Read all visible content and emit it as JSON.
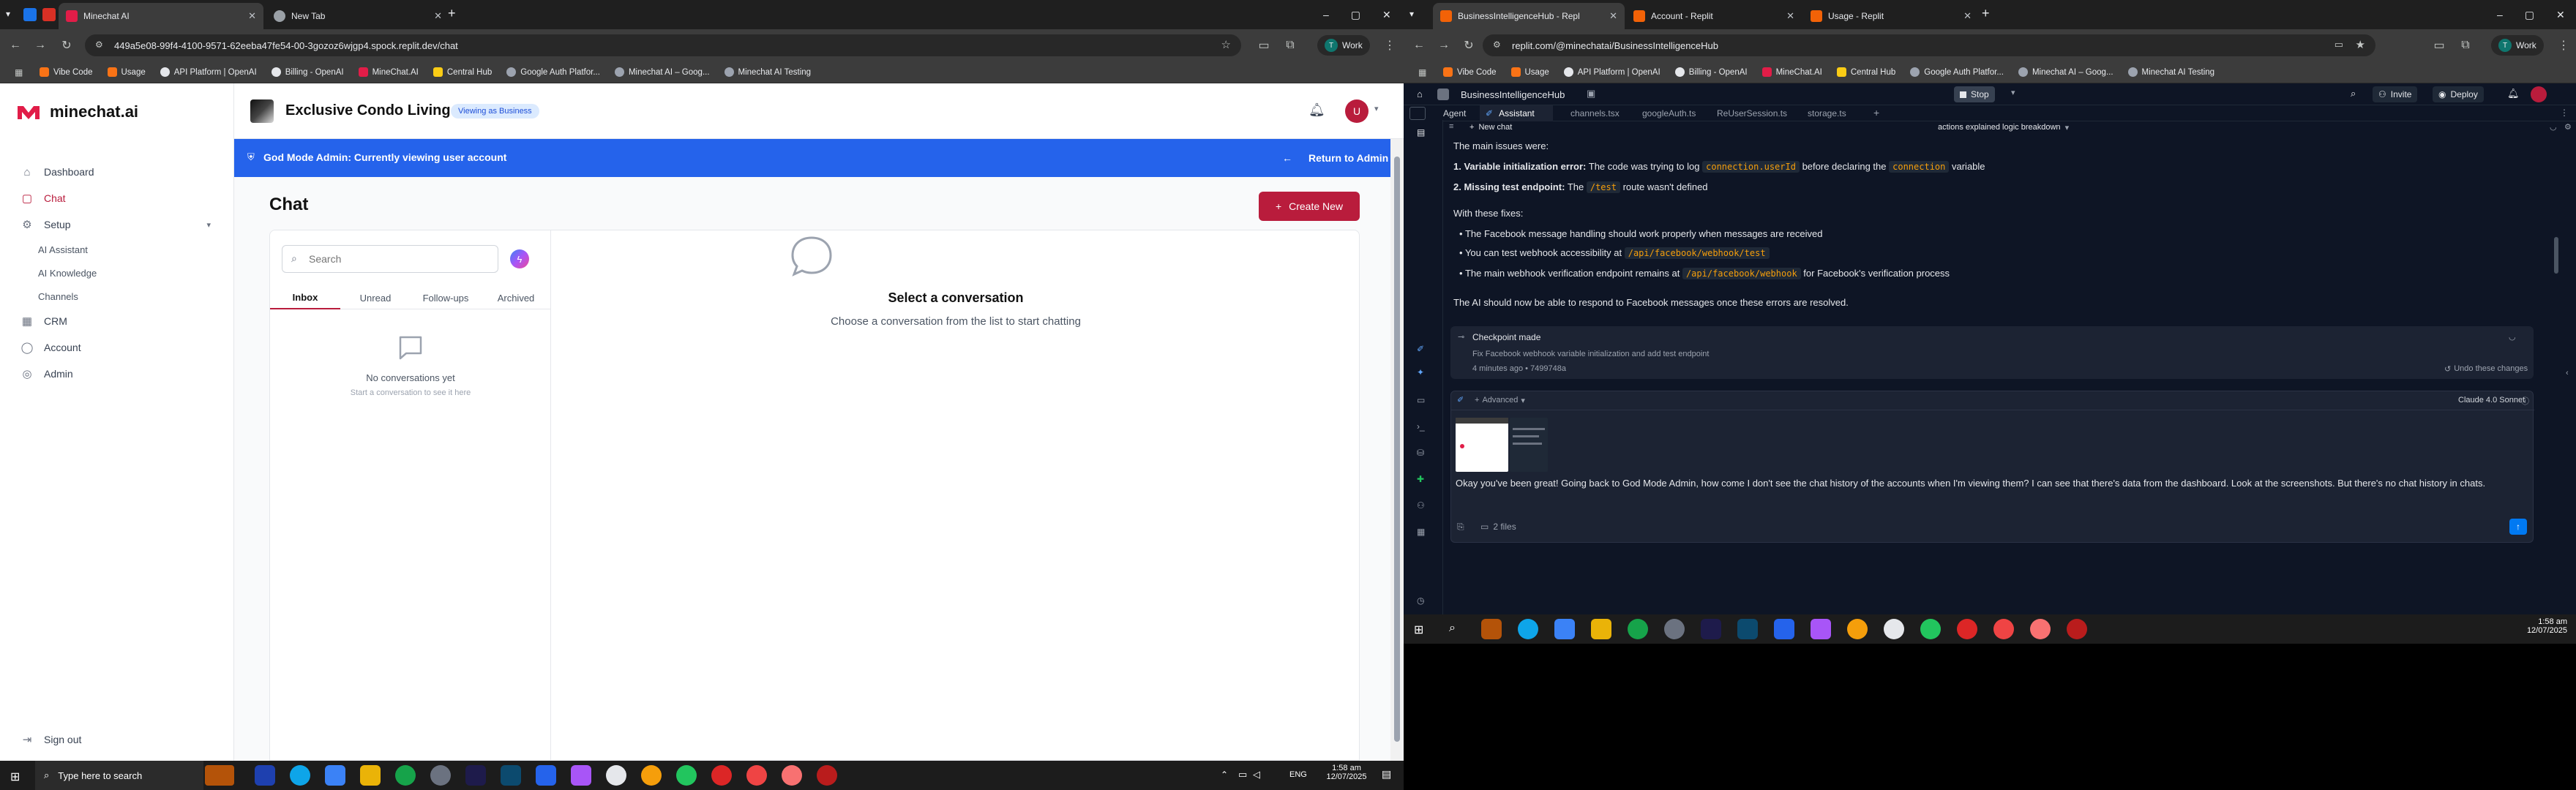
{
  "left_browser": {
    "tabs": [
      {
        "title": "Minechat AI",
        "active": true
      },
      {
        "title": "New Tab",
        "active": false
      }
    ],
    "url": "449a5e08-99f4-4100-9571-62eeba47fe54-00-3gozoz6wjgp4.spock.replit.dev/chat",
    "profile_label": "Work",
    "bookmarks": [
      "Vibe Code",
      "Usage",
      "API Platform | OpenAI",
      "Billing - OpenAI",
      "MineChat.AI",
      "Central Hub",
      "Google Auth Platfor...",
      "Minechat AI – Goog...",
      "Minechat AI Testing"
    ]
  },
  "app": {
    "brand": "minechat.ai",
    "business_name": "Exclusive Condo Living",
    "viewing_badge": "Viewing as Business",
    "avatar_letter": "U",
    "banner_text": "God Mode Admin: Currently viewing user account",
    "return_label": "Return to Admin",
    "sidebar": {
      "items": [
        {
          "label": "Dashboard"
        },
        {
          "label": "Chat"
        },
        {
          "label": "Setup"
        },
        {
          "label": "CRM"
        },
        {
          "label": "Account"
        },
        {
          "label": "Admin"
        }
      ],
      "setup_sub": [
        "AI Assistant",
        "AI Knowledge",
        "Channels"
      ],
      "signout": "Sign out"
    },
    "chat": {
      "title": "Chat",
      "create_label": "Create New",
      "search_placeholder": "Search",
      "tabs": [
        "Inbox",
        "Unread",
        "Follow-ups",
        "Archived"
      ],
      "empty_title": "No conversations yet",
      "empty_sub": "Start a conversation to see it here",
      "select_title": "Select a conversation",
      "select_sub": "Choose a conversation from the list to start chatting"
    }
  },
  "right_browser": {
    "tabs": [
      {
        "title": "BusinessIntelligenceHub - Repl",
        "active": true
      },
      {
        "title": "Account - Replit",
        "active": false
      },
      {
        "title": "Usage - Replit",
        "active": false
      }
    ],
    "url": "replit.com/@minechatai/BusinessIntelligenceHub",
    "profile_label": "Work",
    "bookmarks": [
      "Vibe Code",
      "Usage",
      "API Platform | OpenAI",
      "Billing - OpenAI",
      "MineChat.AI",
      "Central Hub",
      "Google Auth Platfor...",
      "Minechat AI – Goog...",
      "Minechat AI Testing"
    ]
  },
  "replit": {
    "project": "BusinessIntelligenceHub",
    "stop_label": "Stop",
    "invite_label": "Invite",
    "deploy_label": "Deploy",
    "file_tabs": [
      "Agent",
      "Assistant",
      "channels.tsx",
      "googleAuth.ts",
      "ReUserSession.ts",
      "storage.ts"
    ],
    "new_chat": "New chat",
    "chat_title": "actions explained logic breakdown",
    "main_issues": "The main issues were:",
    "issue1_bold": "Variable initialization error:",
    "issue1_text": "The code was trying to log",
    "issue1_code1": "connection.userId",
    "issue1_text2": "before declaring the",
    "issue1_code2": "connection",
    "issue1_text3": "variable",
    "issue2_bold": "Missing test endpoint:",
    "issue2_text": "The",
    "issue2_code": "/test",
    "issue2_text2": "route wasn't defined",
    "fixes_title": "With these fixes:",
    "fix1": "The Facebook message handling should work properly when messages are received",
    "fix2_text": "You can test webhook accessibility at",
    "fix2_code": "/api/facebook/webhook/test",
    "fix3_text": "The main webhook verification endpoint remains at",
    "fix3_code": "/api/facebook/webhook",
    "fix3_text2": "for Facebook's verification process",
    "conclusion": "The AI should now be able to respond to Facebook messages once these errors are resolved.",
    "checkpoint_title": "Checkpoint made",
    "checkpoint_desc": "Fix Facebook webhook variable initialization and add test endpoint",
    "checkpoint_meta": "4 minutes ago • 7499748a",
    "undo_label": "Undo these changes",
    "advanced_label": "Advanced",
    "model_label": "Claude 4.0 Sonnet",
    "user_message": "Okay you've been great! Going back to God Mode Admin, how come I don't see the chat history of the accounts when I'm viewing them? I can see that there's data from the dashboard. Look at the screenshots. But there's no chat history in chats.",
    "files_label": "2 files"
  },
  "taskbar_left": {
    "search_placeholder": "Type here to search",
    "lang": "ENG",
    "time": "1:58 am",
    "date": "12/07/2025"
  },
  "taskbar_right": {
    "time": "1:58 am",
    "date": "12/07/2025"
  },
  "colors": {
    "brand_red": "#b91c3c",
    "banner_blue": "#2563eb",
    "replit_bg": "#0e1525"
  }
}
